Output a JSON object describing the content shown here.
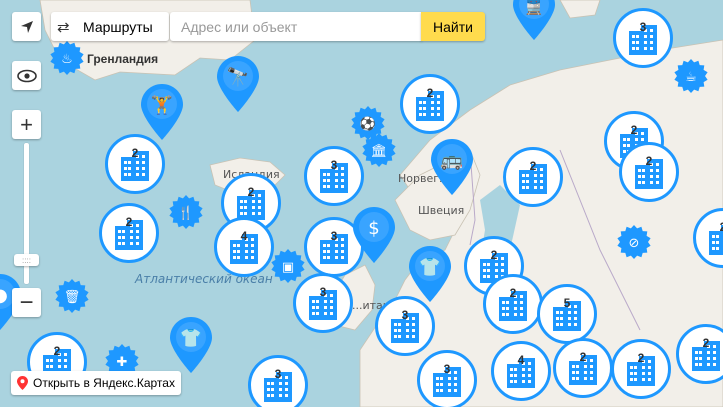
{
  "controls": {
    "routes_label": "Маршруты",
    "search_placeholder": "Адрес или объект",
    "find_label": "Найти",
    "zoom_in": "+",
    "zoom_out": "−",
    "open_yandex": "Открыть в Яндекс.Картах"
  },
  "labels": {
    "greenland": "Гренландия",
    "iceland": "Исландия",
    "norway": "Норвег...",
    "sweden": "Швеция",
    "atlantic": "Атлантический океан",
    "britain": "...итания"
  },
  "colors": {
    "accent": "#1e98ff",
    "find_button": "#ffdb4d",
    "water": "#aad3df",
    "land": "#f2efe9"
  },
  "clusters": [
    {
      "count": "2"
    },
    {
      "count": "3"
    },
    {
      "count": "2"
    },
    {
      "count": "2"
    },
    {
      "count": "2"
    },
    {
      "count": "3"
    },
    {
      "count": "2"
    },
    {
      "count": "2"
    },
    {
      "count": "2"
    },
    {
      "count": "4"
    },
    {
      "count": "3"
    },
    {
      "count": "2"
    },
    {
      "count": "3"
    },
    {
      "count": "2"
    },
    {
      "count": "3"
    },
    {
      "count": "5"
    },
    {
      "count": "2"
    },
    {
      "count": "3"
    },
    {
      "count": "3"
    },
    {
      "count": "4"
    },
    {
      "count": "2"
    },
    {
      "count": "2"
    },
    {
      "count": "2"
    },
    {
      "count": "2"
    }
  ],
  "markers": [
    {
      "icon": "gym-icon"
    },
    {
      "icon": "telescope-icon"
    },
    {
      "icon": "bus-icon"
    },
    {
      "icon": "money-icon"
    },
    {
      "icon": "clothes-icon"
    },
    {
      "icon": "clothes-icon"
    },
    {
      "icon": "train-icon"
    },
    {
      "icon": "pin-icon"
    }
  ],
  "badges": [
    {
      "icon": "bath-icon"
    },
    {
      "icon": "sport-icon"
    },
    {
      "icon": "museum-icon"
    },
    {
      "icon": "food-icon"
    },
    {
      "icon": "archive-icon"
    },
    {
      "icon": "trash-icon"
    },
    {
      "icon": "hospital-icon"
    },
    {
      "icon": "no-icon"
    },
    {
      "icon": "cafe-icon"
    }
  ]
}
